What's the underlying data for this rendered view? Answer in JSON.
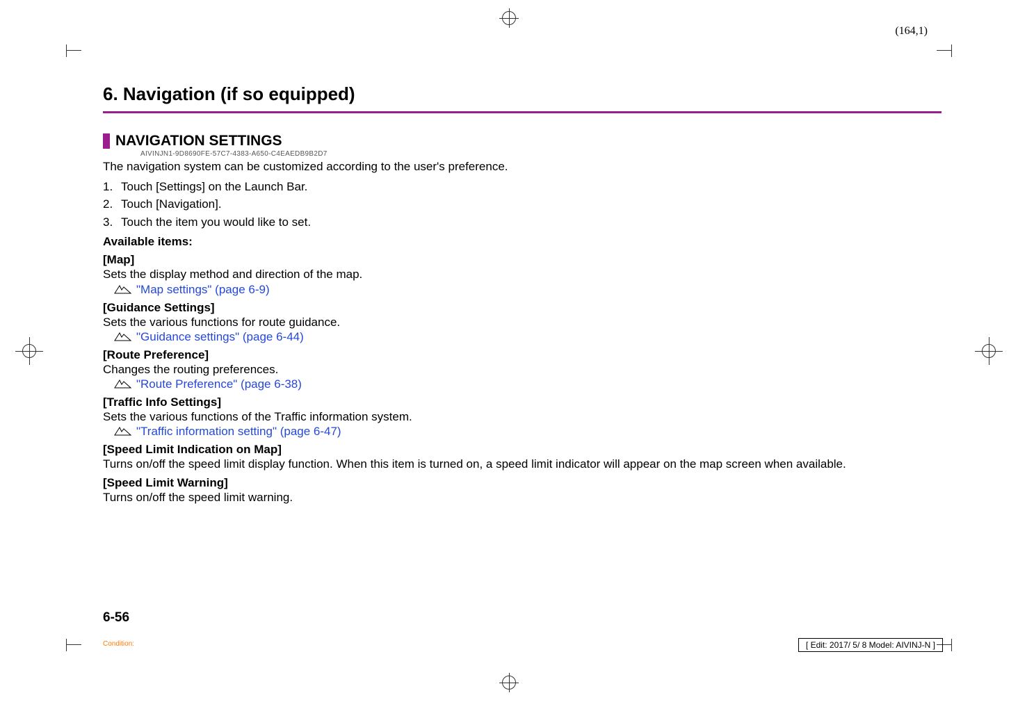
{
  "print_marks": {
    "coord": "(164,1)"
  },
  "chapter": {
    "title": "6. Navigation (if so equipped)"
  },
  "section": {
    "title": "NAVIGATION SETTINGS",
    "code": "AIVINJN1-9D8690FE-57C7-4383-A650-C4EAEDB9B2D7"
  },
  "intro": "The navigation system can be customized according to the user's preference.",
  "steps": [
    {
      "n": "1.",
      "text": "Touch [Settings] on the Launch Bar."
    },
    {
      "n": "2.",
      "text": "Touch [Navigation]."
    },
    {
      "n": "3.",
      "text": "Touch the item you would like to set."
    }
  ],
  "available_label": "Available items:",
  "items": [
    {
      "heading": "[Map]",
      "desc": "Sets the display method and direction of the map.",
      "ref": "\"Map settings\" (page 6-9)"
    },
    {
      "heading": "[Guidance Settings]",
      "desc": "Sets the various functions for route guidance.",
      "ref": "\"Guidance settings\" (page 6-44)"
    },
    {
      "heading": "[Route Preference]",
      "desc": "Changes the routing preferences.",
      "ref": "\"Route Preference\" (page 6-38)"
    },
    {
      "heading": "[Traffic Info Settings]",
      "desc": "Sets the various functions of the Traffic information system.",
      "ref": "\"Traffic information setting\" (page 6-47)"
    },
    {
      "heading": "[Speed Limit Indication on Map]",
      "desc": "Turns on/off the speed limit display function. When this item is turned on, a speed limit indicator will appear on the map screen when available.",
      "ref": ""
    },
    {
      "heading": "[Speed Limit Warning]",
      "desc": "Turns on/off the speed limit warning.",
      "ref": ""
    }
  ],
  "page_number": "6-56",
  "condition_label": "Condition:",
  "edit_box": "[ Edit: 2017/ 5/ 8   Model: AIVINJ-N ]"
}
